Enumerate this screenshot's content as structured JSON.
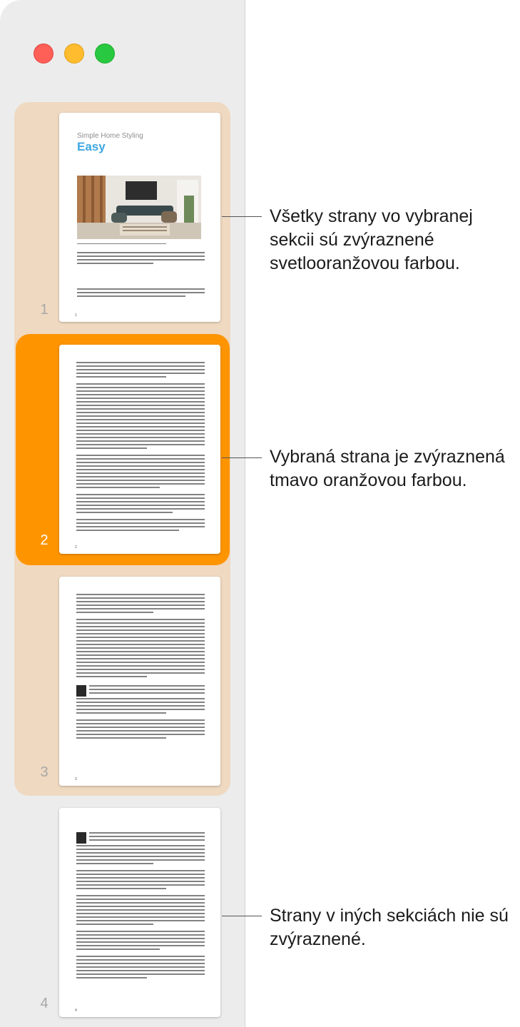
{
  "window": {
    "controls": [
      "close",
      "minimize",
      "zoom"
    ]
  },
  "pages": [
    {
      "number": "1",
      "title": "Simple Home Styling",
      "heading": "Easy",
      "photo": "living-room-photo"
    },
    {
      "number": "2"
    },
    {
      "number": "3"
    },
    {
      "number": "4"
    }
  ],
  "callouts": [
    "Všetky strany vo vybranej sekcii sú zvýraznené svetlooranžovou farbou.",
    "Vybraná strana je zvýraznená tmavo oranžovou farbou.",
    "Strany v iných sekciách nie sú zvýraznené."
  ],
  "colors": {
    "section_highlight": "#efd9c1",
    "selected_highlight": "#fe9500",
    "sidebar_bg": "#ececec"
  }
}
